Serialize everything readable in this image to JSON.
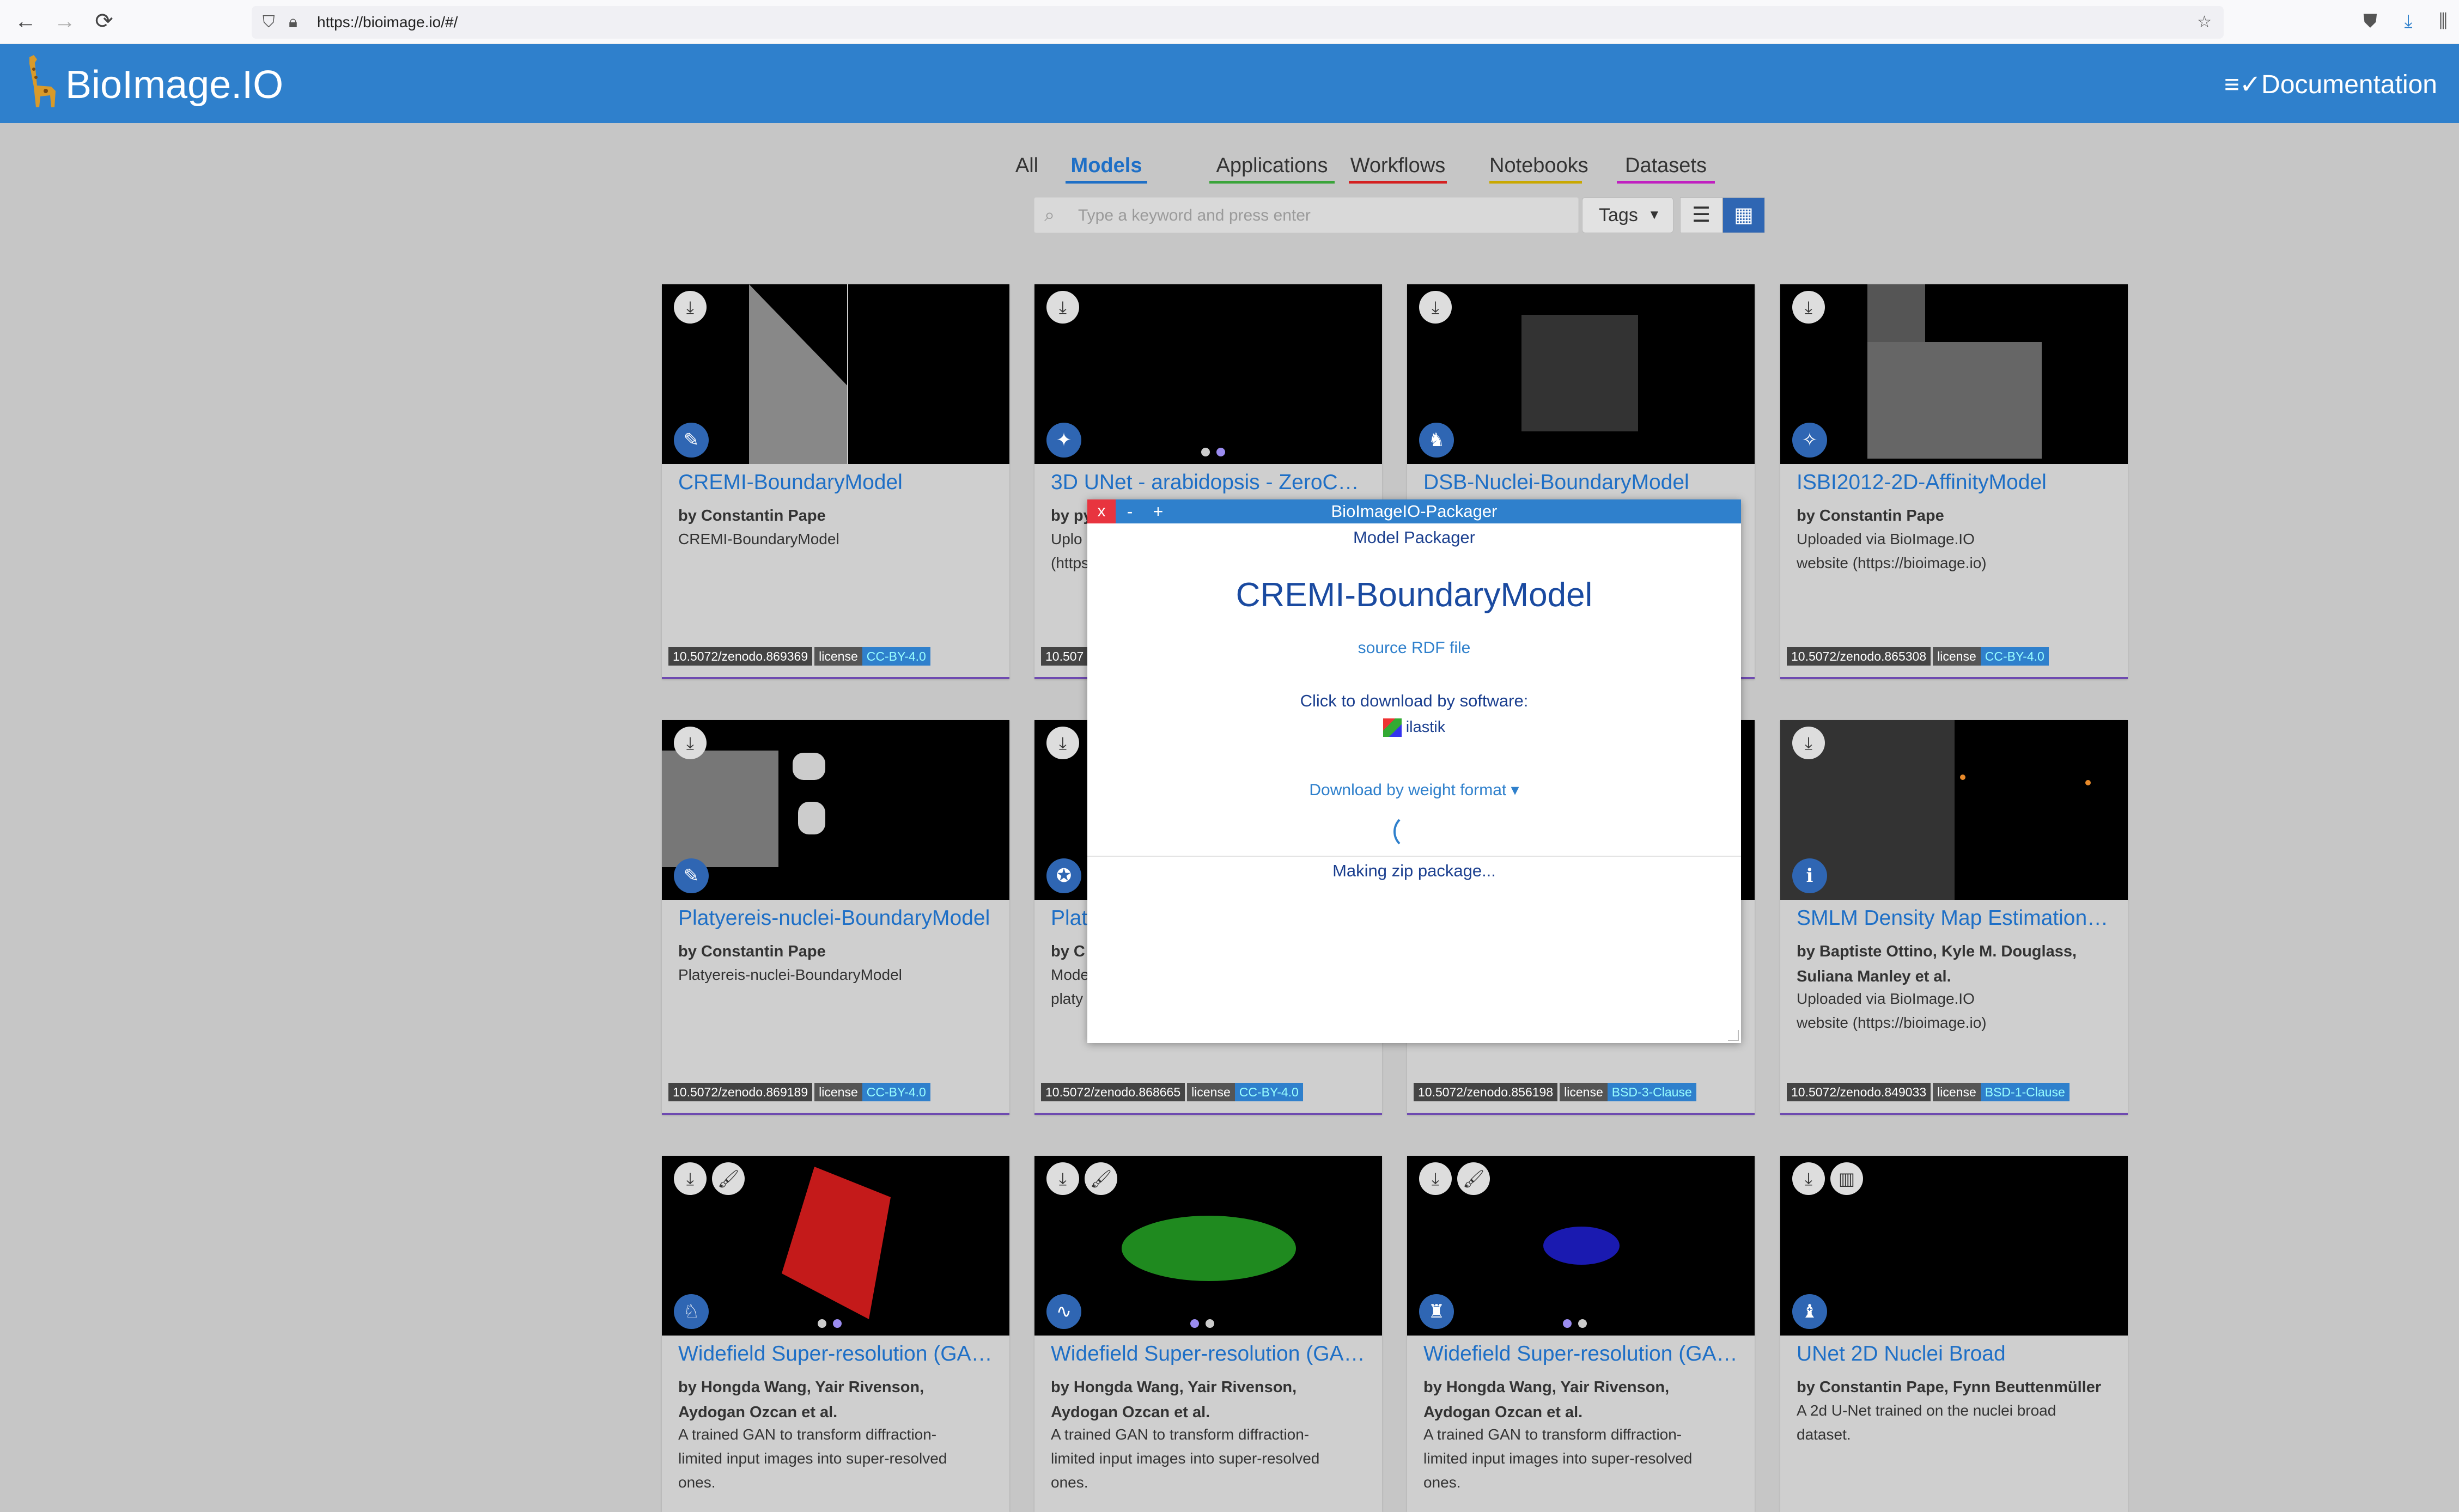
{
  "browser": {
    "url": "https://bioimage.io/#/",
    "back": "←",
    "forward": "→",
    "reload": "⟳",
    "star": "☆"
  },
  "header": {
    "title": "BioImage.IO",
    "documentation": "≡✓Documentation"
  },
  "tabs": [
    "All",
    "Models",
    "Applications",
    "Workflows",
    "Notebooks",
    "Datasets"
  ],
  "tab_colors": [
    "#555555",
    "#1e6fc6",
    "#3aa43a",
    "#d42020",
    "#c9a800",
    "#c020c0"
  ],
  "search": {
    "placeholder": "Type a keyword and press enter"
  },
  "tags_button": "Tags",
  "cards": [
    {
      "title": "CREMI-BoundaryModel",
      "authors": "by Constantin Pape",
      "desc": "CREMI-BoundaryModel",
      "doi": "10.5072/zenodo.869369",
      "license_label": "license",
      "license": "CC-BY-4.0"
    },
    {
      "title": "3D UNet - arabidopsis - ZeroC…",
      "authors": "by py",
      "desc": "Uplo (https",
      "doi": "10.507",
      "license_label": "",
      "license": ""
    },
    {
      "title": "DSB-Nuclei-BoundaryModel",
      "authors": "",
      "desc": "",
      "doi": "",
      "license_label": "",
      "license": ""
    },
    {
      "title": "ISBI2012-2D-AffinityModel",
      "authors": "by Constantin Pape",
      "desc": "Uploaded via BioImage.IO website (https://bioimage.io)",
      "doi": "10.5072/zenodo.865308",
      "license_label": "license",
      "license": "CC-BY-4.0"
    },
    {
      "title": "Platyereis-nuclei-BoundaryModel",
      "authors": "by Constantin Pape",
      "desc": "Platyereis-nuclei-BoundaryModel",
      "doi": "10.5072/zenodo.869189",
      "license_label": "license",
      "license": "CC-BY-4.0"
    },
    {
      "title": "Plat",
      "authors": "by C",
      "desc": "Mode platy",
      "doi": "10.5072/zenodo.868665",
      "license_label": "license",
      "license": "CC-BY-4.0"
    },
    {
      "title": "",
      "authors": "",
      "desc": "",
      "doi": "10.5072/zenodo.856198",
      "license_label": "license",
      "license": "BSD-3-Clause"
    },
    {
      "title": "SMLM Density Map Estimation…",
      "authors": "by Baptiste Ottino, Kyle M. Douglass, Suliana Manley et al.",
      "desc": "Uploaded via BioImage.IO website (https://bioimage.io)",
      "doi": "10.5072/zenodo.849033",
      "license_label": "license",
      "license": "BSD-1-Clause"
    },
    {
      "title": "Widefield Super-resolution (GA…",
      "authors": "by Hongda Wang, Yair Rivenson, Aydogan Ozcan et al.",
      "desc": "A trained GAN to transform diffraction-limited input images into super-resolved ones.",
      "doi": "",
      "license_label": "",
      "license": ""
    },
    {
      "title": "Widefield Super-resolution (GA…",
      "authors": "by Hongda Wang, Yair Rivenson, Aydogan Ozcan et al.",
      "desc": "A trained GAN to transform diffraction-limited input images into super-resolved ones.",
      "doi": "",
      "license_label": "",
      "license": ""
    },
    {
      "title": "Widefield Super-resolution (GA…",
      "authors": "by Hongda Wang, Yair Rivenson, Aydogan Ozcan et al.",
      "desc": "A trained GAN to transform diffraction-limited input images into super-resolved ones.",
      "doi": "",
      "license_label": "",
      "license": ""
    },
    {
      "title": "UNet 2D Nuclei Broad",
      "authors": "by Constantin Pape, Fynn Beuttenmüller",
      "desc": "A 2d U-Net trained on the nuclei broad dataset.",
      "doi": "",
      "license_label": "",
      "license": ""
    }
  ],
  "dialog": {
    "close": "x",
    "minimize": "-",
    "maximize": "+",
    "window_title": "BioImageIO-Packager",
    "heading": "Model Packager",
    "model_name": "CREMI-BoundaryModel",
    "source_link": "source RDF file",
    "download_prompt": "Click to download by software:",
    "software": "ilastik",
    "weight_format": "Download by weight format ▾",
    "status": "Making zip package..."
  }
}
